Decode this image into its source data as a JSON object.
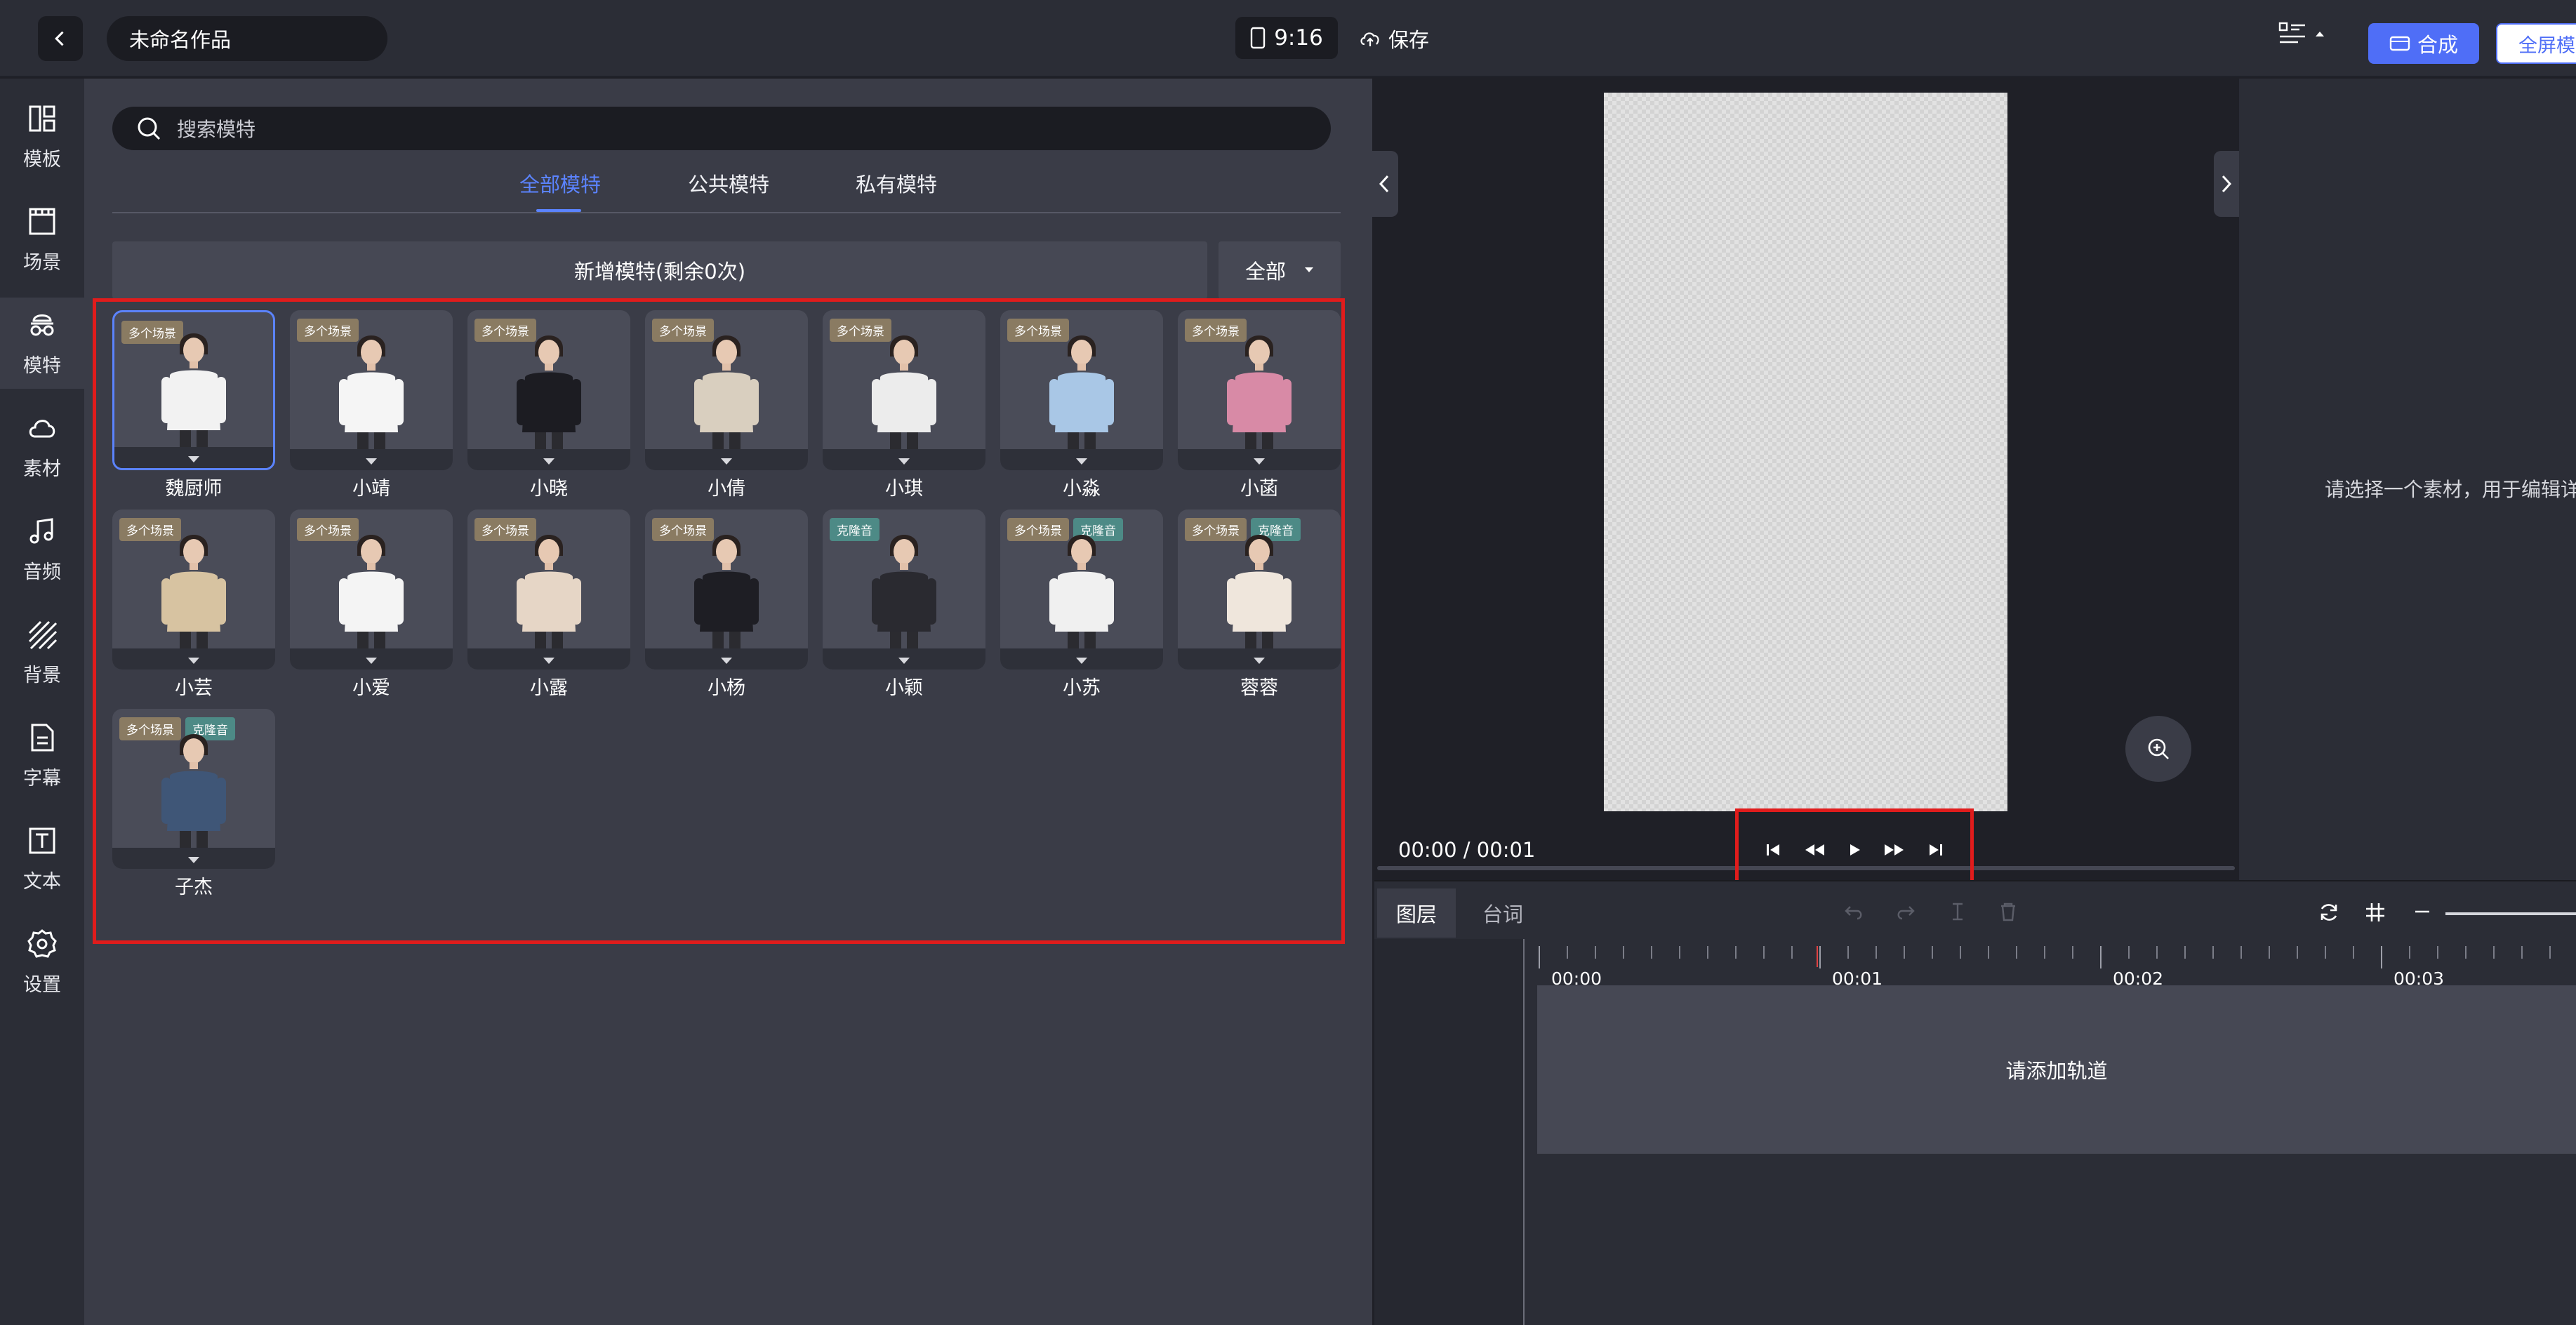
{
  "header": {
    "project_title": "未命名作品",
    "aspect_ratio": "9:16",
    "save_label": "保存",
    "compose_label": "合成",
    "fullscreen_label": "全屏模"
  },
  "sidebar": {
    "items": [
      {
        "label": "模板",
        "icon": "template-icon"
      },
      {
        "label": "场景",
        "icon": "clapperboard-icon"
      },
      {
        "label": "模特",
        "icon": "model-icon",
        "active": true
      },
      {
        "label": "素材",
        "icon": "cloud-icon"
      },
      {
        "label": "音频",
        "icon": "music-icon"
      },
      {
        "label": "背景",
        "icon": "stripes-icon"
      },
      {
        "label": "字幕",
        "icon": "document-icon"
      },
      {
        "label": "文本",
        "icon": "text-icon"
      },
      {
        "label": "设置",
        "icon": "gear-icon"
      }
    ]
  },
  "models_panel": {
    "search_placeholder": "搜索模特",
    "tabs": [
      {
        "label": "全部模特",
        "active": true
      },
      {
        "label": "公共模特"
      },
      {
        "label": "私有模特"
      }
    ],
    "add_model_label": "新增模特(剩余0次)",
    "filter_label": "全部",
    "badge_multi": "多个场景",
    "badge_clone": "克隆音",
    "models": [
      {
        "name": "魏厨师",
        "badges": [
          "多个场景"
        ],
        "selected": true,
        "outfit": "#f2f2f2"
      },
      {
        "name": "小靖",
        "badges": [
          "多个场景"
        ],
        "outfit": "#f5f5f5"
      },
      {
        "name": "小晓",
        "badges": [
          "多个场景"
        ],
        "outfit": "#1c1c22"
      },
      {
        "name": "小倩",
        "badges": [
          "多个场景"
        ],
        "outfit": "#d9cfbf"
      },
      {
        "name": "小琪",
        "badges": [
          "多个场景"
        ],
        "outfit": "#ececec"
      },
      {
        "name": "小淼",
        "badges": [
          "多个场景"
        ],
        "outfit": "#a9c7e6"
      },
      {
        "name": "小菡",
        "badges": [
          "多个场景"
        ],
        "outfit": "#d88aa6"
      },
      {
        "name": "小芸",
        "badges": [
          "多个场景"
        ],
        "outfit": "#d7c3a1"
      },
      {
        "name": "小爱",
        "badges": [
          "多个场景"
        ],
        "outfit": "#f4f4f4"
      },
      {
        "name": "小露",
        "badges": [
          "多个场景"
        ],
        "outfit": "#e6d6c6"
      },
      {
        "name": "小杨",
        "badges": [
          "多个场景"
        ],
        "outfit": "#1e1e24"
      },
      {
        "name": "小颖",
        "badges": [
          "克隆音"
        ],
        "outfit": "#2a2a30"
      },
      {
        "name": "小苏",
        "badges": [
          "多个场景",
          "克隆音"
        ],
        "outfit": "#f0f0f0"
      },
      {
        "name": "蓉蓉",
        "badges": [
          "多个场景",
          "克隆音"
        ],
        "outfit": "#efe6dc"
      },
      {
        "name": "子杰",
        "badges": [
          "多个场景",
          "克隆音"
        ],
        "outfit": "#3f5677"
      }
    ]
  },
  "preview": {
    "current_time": "00:00",
    "total_time": "00:01"
  },
  "properties": {
    "hint": "请选择一个素材，用于编辑详"
  },
  "timeline": {
    "tabs": [
      {
        "label": "图层",
        "active": true
      },
      {
        "label": "台词"
      }
    ],
    "ticks": [
      "00:00",
      "00:01",
      "00:02",
      "00:03"
    ],
    "empty_track_label": "请添加轨道"
  },
  "colors": {
    "accent": "#4f6ef7",
    "highlight_box": "#e01c1c",
    "badge_multi": "#8a7b62",
    "badge_clone": "#4d8a86"
  }
}
